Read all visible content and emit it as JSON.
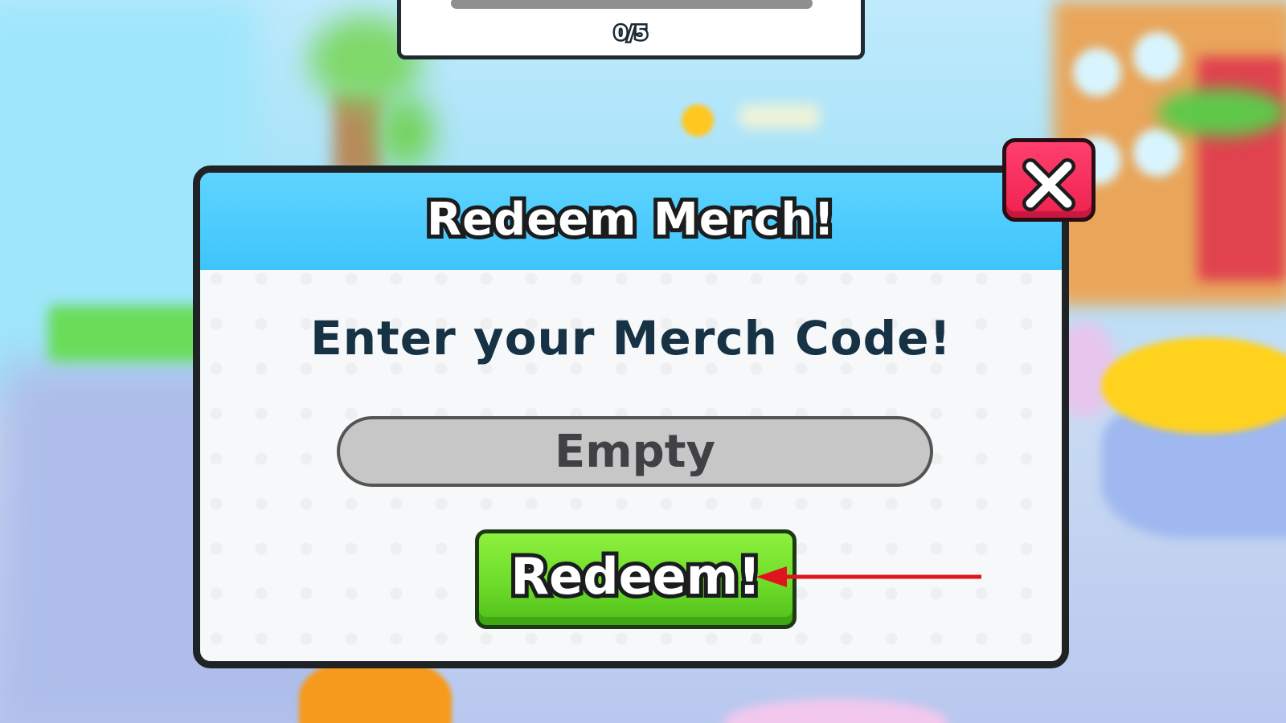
{
  "quest_panel": {
    "progress_text": "0/5",
    "progress_fraction": 0
  },
  "modal": {
    "title": "Redeem Merch!",
    "prompt": "Enter your Merch Code!",
    "code_input": {
      "value": "",
      "placeholder": "Empty"
    },
    "redeem_label": "Redeem!",
    "close_icon": "close-icon"
  },
  "annotation": {
    "arrow_color": "#e0141e",
    "arrow_icon": "red-arrow-pointing-left"
  },
  "colors": {
    "header": "#3fc4fb",
    "redeem_button": "#6edc2a",
    "close_button": "#f0224f",
    "prompt_text": "#163244"
  }
}
